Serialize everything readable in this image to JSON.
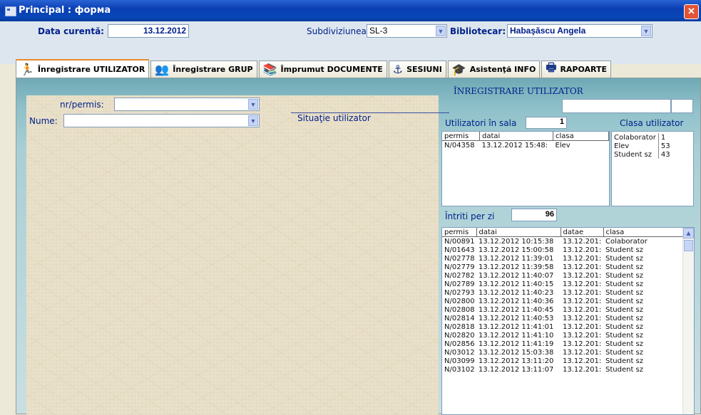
{
  "window": {
    "title": "Principal : форма",
    "close_glyph": "✕"
  },
  "header": {
    "date_label": "Data curentă:",
    "date_value": "13.12.2012",
    "subdiv_label": "Subdiviziunea:",
    "subdiv_value": "SL-3",
    "librarian_label": "Bibliotecar:",
    "librarian_value": "Habaşăscu Angela"
  },
  "tabs": [
    {
      "label": "Înregistrare UTILIZATOR",
      "icon": "running-person-icon",
      "glyph": "🏃"
    },
    {
      "label": "Înregistrare GRUP",
      "icon": "group-icon",
      "glyph": "👥"
    },
    {
      "label": "Împrumut DOCUMENTE",
      "icon": "books-icon",
      "glyph": "📚"
    },
    {
      "label": "SESIUNI",
      "icon": "anchor-icon",
      "glyph": "⚓"
    },
    {
      "label": "Asistenţă INFO",
      "icon": "assistant-icon",
      "glyph": "🎓"
    },
    {
      "label": "RAPOARTE",
      "icon": "printer-icon",
      "glyph": "🖶"
    }
  ],
  "form": {
    "permis_label": "nr/permis:",
    "name_label": "Nume:",
    "situation_label": "Situaţie utilizator"
  },
  "right": {
    "section_title": "ÎNREGISTRARE UTILIZATOR",
    "in_hall_label": "Utilizatori în sala",
    "in_hall_value": "1",
    "class_label": "Clasa utilizator",
    "per_day_label": "Întriti per zi",
    "per_day_value": "96"
  },
  "hall_table": {
    "columns": [
      "permis",
      "datai",
      "clasa"
    ],
    "rows": [
      [
        "N/04358",
        "13.12.2012 15:48:",
        "Elev"
      ]
    ]
  },
  "class_table": {
    "rows": [
      [
        "Colaborator",
        "1"
      ],
      [
        "Elev",
        "53"
      ],
      [
        "Student sz",
        "43"
      ]
    ]
  },
  "day_table": {
    "columns": [
      "permis",
      "datai",
      "datae",
      "clasa"
    ],
    "rows": [
      [
        "N/00891",
        "13.12.2012 10:15:38",
        "13.12.201:",
        "Colaborator"
      ],
      [
        "N/01643",
        "13.12.2012 15:00:58",
        "13.12.201:",
        "Student sz"
      ],
      [
        "N/02778",
        "13.12.2012 11:39:01",
        "13.12.201:",
        "Student sz"
      ],
      [
        "N/02779",
        "13.12.2012 11:39:58",
        "13.12.201:",
        "Student sz"
      ],
      [
        "N/02782",
        "13.12.2012 11:40:07",
        "13.12.201:",
        "Student sz"
      ],
      [
        "N/02789",
        "13.12.2012 11:40:15",
        "13.12.201:",
        "Student sz"
      ],
      [
        "N/02793",
        "13.12.2012 11:40:23",
        "13.12.201:",
        "Student sz"
      ],
      [
        "N/02800",
        "13.12.2012 11:40:36",
        "13.12.201:",
        "Student sz"
      ],
      [
        "N/02808",
        "13.12.2012 11:40:45",
        "13.12.201:",
        "Student sz"
      ],
      [
        "N/02814",
        "13.12.2012 11:40:53",
        "13.12.201:",
        "Student sz"
      ],
      [
        "N/02818",
        "13.12.2012 11:41:01",
        "13.12.201:",
        "Student sz"
      ],
      [
        "N/02820",
        "13.12.2012 11:41:10",
        "13.12.201:",
        "Student sz"
      ],
      [
        "N/02856",
        "13.12.2012 11:41:19",
        "13.12.201:",
        "Student sz"
      ],
      [
        "N/03012",
        "13.12.2012 15:03:38",
        "13.12.201:",
        "Student sz"
      ],
      [
        "N/03099",
        "13.12.2012 13:11:20",
        "13.12.201:",
        "Student sz"
      ],
      [
        "N/03102",
        "13.12.2012 13:11:07",
        "13.12.201:",
        "Student sz"
      ]
    ]
  }
}
